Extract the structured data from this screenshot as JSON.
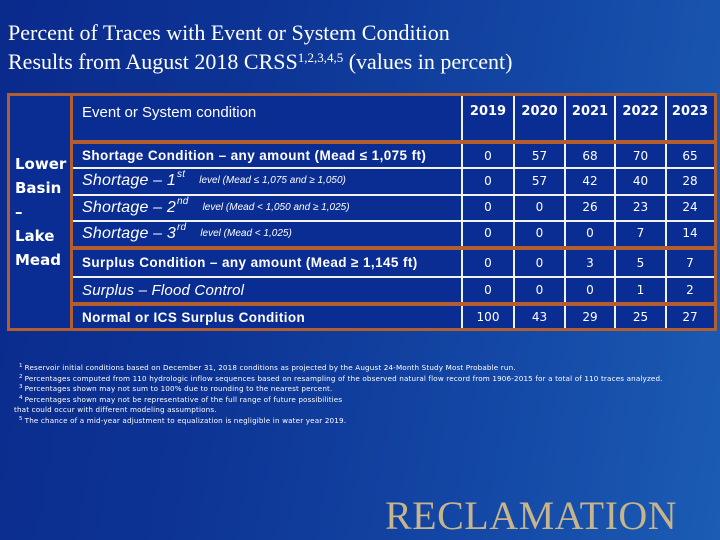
{
  "title": {
    "line1": "Percent of Traces with Event or System Condition",
    "line2_prefix": "Results from August 2018 CRSS",
    "line2_sup": "1,2,3,4,5",
    "line2_suffix": " (values in percent)"
  },
  "table": {
    "basin_label": [
      "Lower",
      "Basin",
      "–",
      "Lake",
      "Mead"
    ],
    "header_label": "Event or System condition",
    "years": [
      "2019",
      "2020",
      "2021",
      "2022",
      "2023"
    ],
    "rows": [
      {
        "label": "Shortage Condition – any amount (Mead ≤ 1,075 ft)",
        "style": "bold",
        "values": [
          "0",
          "57",
          "68",
          "70",
          "65"
        ]
      },
      {
        "label": "Shortage – 1",
        "ordinal": "st",
        "detail": "level (Mead ≤ 1,075 and ≥ 1,050)",
        "style": "italic",
        "values": [
          "0",
          "57",
          "42",
          "40",
          "28"
        ]
      },
      {
        "label": "Shortage – 2",
        "ordinal": "nd",
        "detail": "level (Mead < 1,050 and ≥ 1,025)",
        "style": "italic",
        "values": [
          "0",
          "0",
          "26",
          "23",
          "24"
        ]
      },
      {
        "label": "Shortage – 3",
        "ordinal": "rd",
        "detail": "level (Mead < 1,025)",
        "style": "italic",
        "values": [
          "0",
          "0",
          "0",
          "7",
          "14"
        ]
      },
      {
        "label": "Surplus Condition – any amount (Mead ≥ 1,145 ft)",
        "style": "bold",
        "values": [
          "0",
          "0",
          "3",
          "5",
          "7"
        ]
      },
      {
        "label": "Surplus – Flood Control",
        "style": "italic",
        "values": [
          "0",
          "0",
          "0",
          "1",
          "2"
        ]
      },
      {
        "label": "Normal or ICS Surplus Condition",
        "style": "bold",
        "values": [
          "100",
          "43",
          "29",
          "25",
          "27"
        ]
      }
    ]
  },
  "footnotes": [
    {
      "num": "1",
      "text": "Reservoir initial conditions based on December 31, 2018 conditions as projected by the August 24-Month Study Most Probable run."
    },
    {
      "num": "2",
      "text": "Percentages computed from 110 hydrologic inflow sequences based on resampling of the observed natural flow record from 1906-2015 for a total of 110 traces analyzed."
    },
    {
      "num": "3",
      "text": "Percentages shown may not sum to 100% due to rounding to the nearest percent."
    },
    {
      "num": "4",
      "text": "Percentages shown may not be representative of the full range of future possibilities"
    },
    {
      "num": "",
      "text": "that could occur with different modeling assumptions."
    },
    {
      "num": "5",
      "text": "The chance of a mid-year adjustment to equalization is negligible in water year 2019."
    }
  ],
  "logo": {
    "text": "RECLAMATION"
  },
  "colors": {
    "background": "#0d3596",
    "table_fill": "#0a2d93",
    "border_orange": "#b35e2e",
    "grid_white": "#f2f2f2",
    "logo_gold": "#c7b48a"
  }
}
